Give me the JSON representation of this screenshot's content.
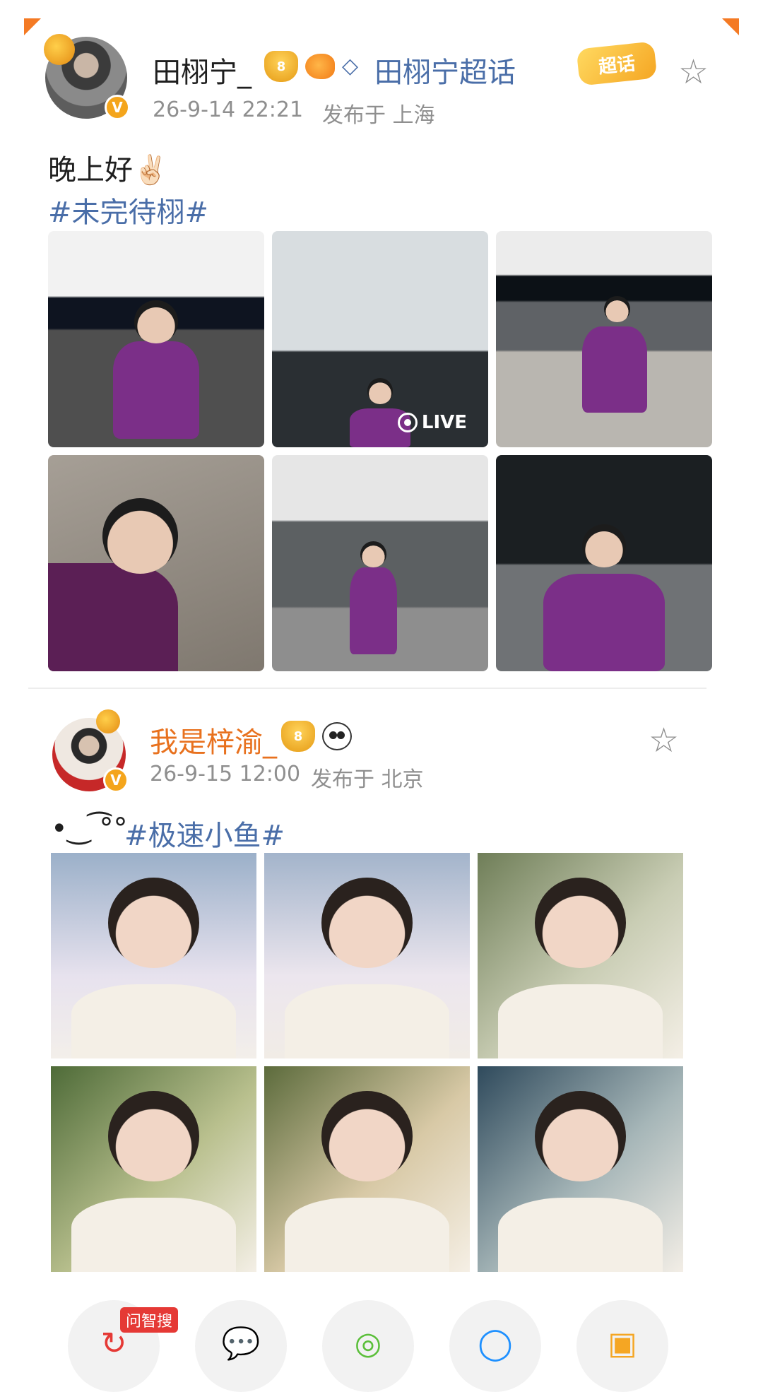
{
  "post1": {
    "username": "田栩宁_",
    "topic_label": "田栩宁超话",
    "supertopic_badge": "超话",
    "verified_mark": "V",
    "timestamp": "26-9-14 22:21",
    "location": "发布于 上海",
    "text": "晚上好✌🏻",
    "hashtag": "#未完待栩#",
    "live_label": "LIVE",
    "images": [
      "photo-1",
      "photo-2",
      "photo-3",
      "photo-4",
      "photo-5",
      "photo-6"
    ]
  },
  "post2": {
    "username": "我是梓渝_",
    "verified_mark": "V",
    "timestamp": "26-9-15 12:00",
    "location": "发布于 北京",
    "text": "•‿ ͡°°",
    "hashtag": "#极速小鱼#",
    "images": [
      "photo-1",
      "photo-2",
      "photo-3",
      "photo-4",
      "photo-5",
      "photo-6"
    ]
  },
  "share_bar": {
    "badge_label": "问智搜",
    "items": [
      {
        "icon": "refresh-icon"
      },
      {
        "icon": "wechat-icon"
      },
      {
        "icon": "moments-icon"
      },
      {
        "icon": "qq-icon"
      },
      {
        "icon": "album-icon"
      }
    ]
  },
  "colors": {
    "accent_orange": "#e8711e",
    "topic_blue": "#4a6ea8",
    "meta_gray": "#8f8f8f",
    "corner_orange": "#f47a24",
    "wzs_red": "#e53935"
  }
}
